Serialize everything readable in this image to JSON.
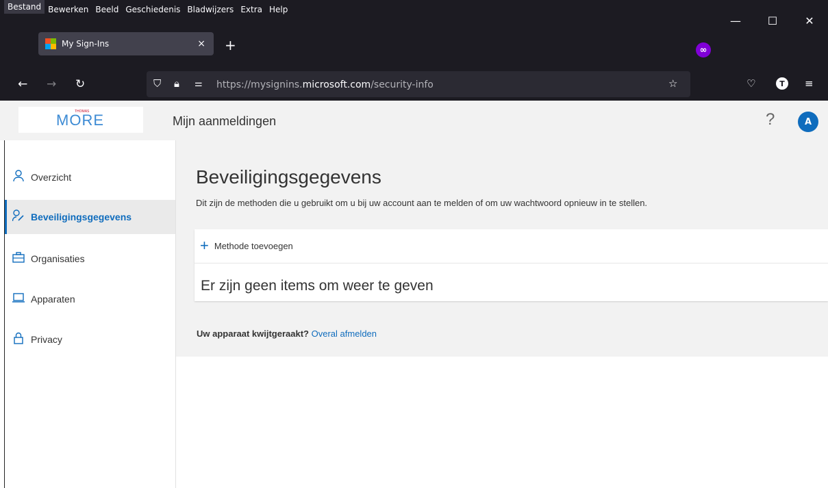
{
  "browser": {
    "menu": [
      "Bestand",
      "Bewerken",
      "Beeld",
      "Geschiedenis",
      "Bladwijzers",
      "Extra",
      "Help"
    ],
    "tab_title": "My Sign-Ins",
    "tab_close": "×",
    "new_tab": "+",
    "url_prefix": "https://mysignins.",
    "url_domain": "microsoft.com",
    "url_path": "/security-info",
    "account_initial": "T",
    "private_icon": "∞",
    "win_minimize": "—",
    "win_maximize": "☐",
    "win_close": "✕"
  },
  "header": {
    "logo_small": "THOMAS",
    "logo_text": "MORE",
    "title": "Mijn aanmeldingen",
    "help": "?",
    "avatar_initial": "A"
  },
  "sidebar": {
    "items": [
      {
        "label": "Overzicht",
        "icon": "person-icon"
      },
      {
        "label": "Beveiligingsgegevens",
        "icon": "security-info-icon"
      },
      {
        "label": "Organisaties",
        "icon": "briefcase-icon"
      },
      {
        "label": "Apparaten",
        "icon": "laptop-icon"
      },
      {
        "label": "Privacy",
        "icon": "lock-icon"
      }
    ]
  },
  "main": {
    "title": "Beveiligingsgegevens",
    "description": "Dit zijn de methoden die u gebruikt om u bij uw account aan te melden of om uw wachtwoord opnieuw in te stellen.",
    "add_method": "Methode toevoegen",
    "empty": "Er zijn geen items om weer te geven",
    "lost_device_question": "Uw apparaat kwijtgeraakt?",
    "lost_device_link": "Overal afmelden"
  },
  "colors": {
    "accent": "#0f6cbd",
    "chrome_bg": "#1c1b22"
  }
}
